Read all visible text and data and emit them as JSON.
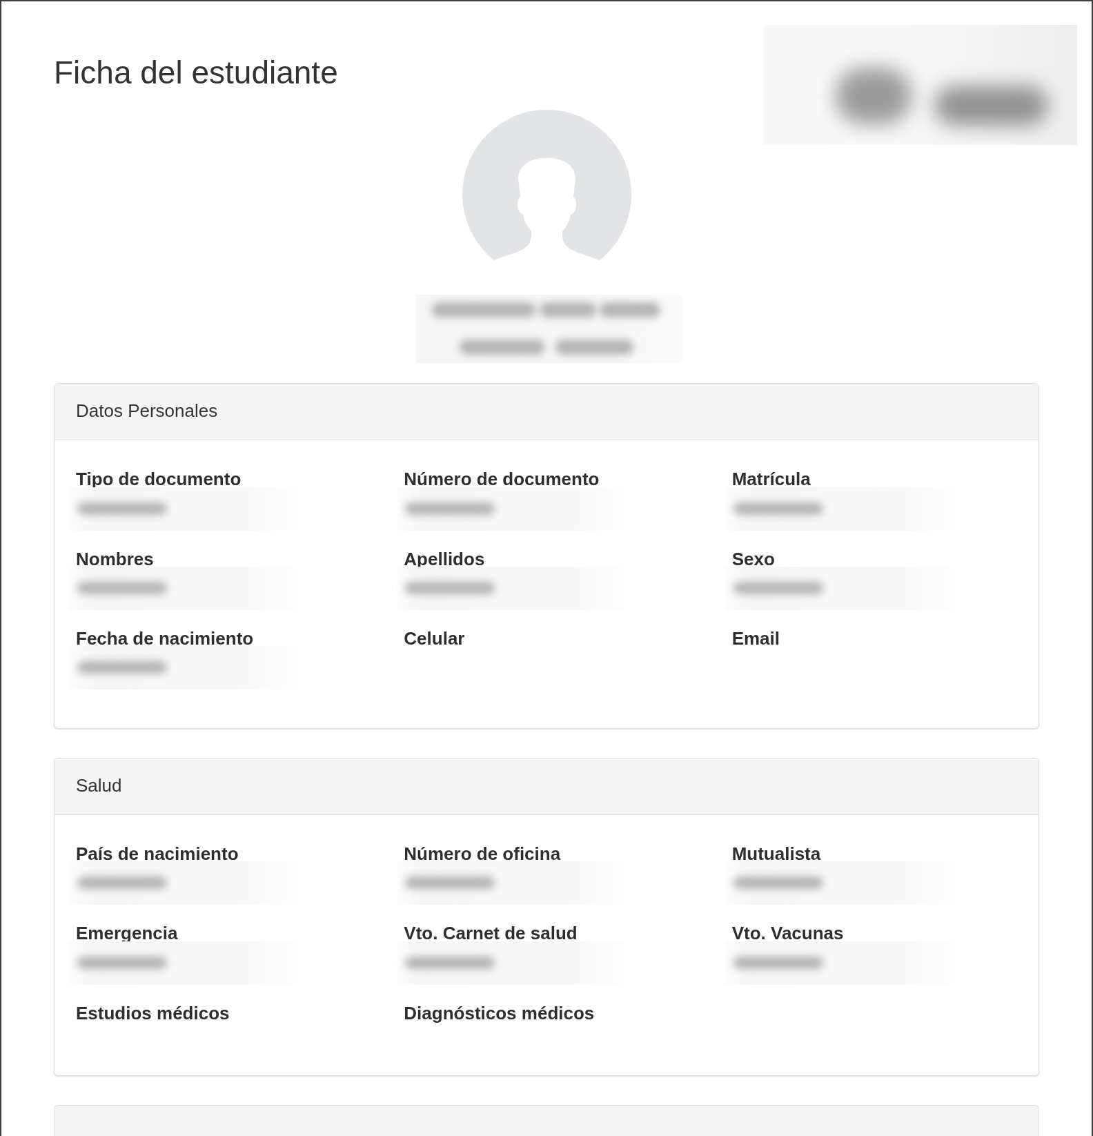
{
  "page": {
    "title": "Ficha del estudiante"
  },
  "logo": {
    "blurred": true
  },
  "student_name": {
    "blurred": true
  },
  "sections": [
    {
      "title": "Datos Personales",
      "fields": [
        {
          "label": "Tipo de documento",
          "value_blurred": true
        },
        {
          "label": "Número de documento",
          "value_blurred": true
        },
        {
          "label": "Matrícula",
          "value_blurred": true
        },
        {
          "label": "Nombres",
          "value_blurred": true
        },
        {
          "label": "Apellidos",
          "value_blurred": true
        },
        {
          "label": "Sexo",
          "value_blurred": true
        },
        {
          "label": "Fecha de nacimiento",
          "value_blurred": true
        },
        {
          "label": "Celular",
          "value_blurred": false
        },
        {
          "label": "Email",
          "value_blurred": false
        }
      ]
    },
    {
      "title": "Salud",
      "fields": [
        {
          "label": "País de nacimiento",
          "value_blurred": true
        },
        {
          "label": "Número de oficina",
          "value_blurred": true
        },
        {
          "label": "Mutualista",
          "value_blurred": true
        },
        {
          "label": "Emergencia",
          "value_blurred": true
        },
        {
          "label": "Vto. Carnet de salud",
          "value_blurred": true
        },
        {
          "label": "Vto. Vacunas",
          "value_blurred": true
        },
        {
          "label": "Estudios médicos",
          "value_blurred": false
        },
        {
          "label": "Diagnósticos médicos",
          "value_blurred": false
        }
      ]
    }
  ],
  "more_sections_below": true
}
